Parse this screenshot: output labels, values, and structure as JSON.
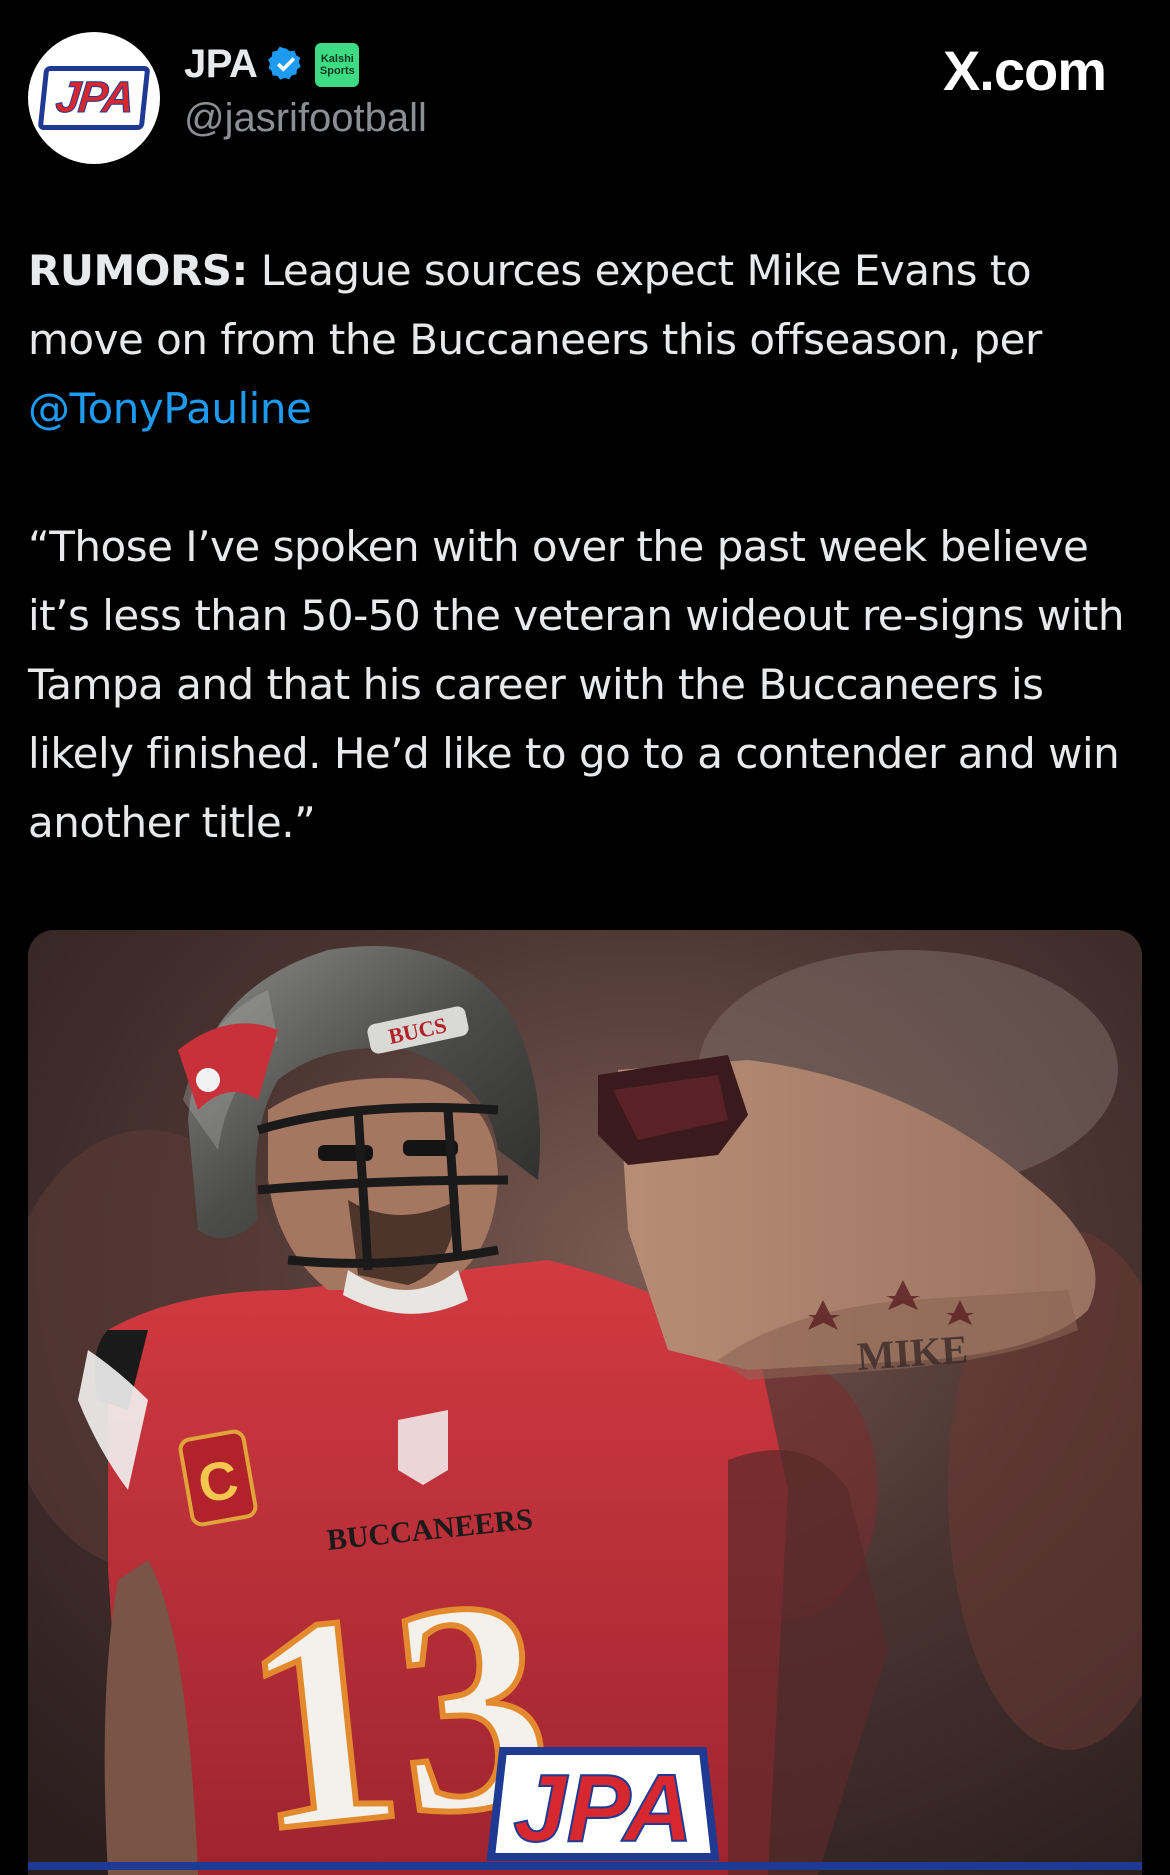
{
  "header": {
    "avatar_logo_text": "JPA",
    "display_name": "JPA",
    "affiliate_badge": "Kalshi Sports",
    "handle": "@jasrifootball",
    "site_label": "X.com"
  },
  "tweet": {
    "tag": "RUMORS:",
    "line1_text": " League sources expect Mike Evans to move on from the Buccaneers this offseason, per ",
    "mention": "@TonyPauline",
    "quote": "“Those I’ve spoken with over the past week believe it’s less than 50-50 the veteran wideout re-signs with Tampa and that his career with the Buccaneers is likely finished. He’d like to go to a contender and win another title.”"
  },
  "media": {
    "jersey_text": "BUCCANEERS",
    "jersey_number": "13",
    "helmet_text": "BUCS",
    "tattoo_text": "MIKE",
    "captain_patch": "C",
    "watermark": "JPA"
  },
  "colors": {
    "background": "#000000",
    "text": "#e7e9ea",
    "muted": "#8b8f94",
    "link": "#1d9bf0",
    "verified": "#1d9bf0",
    "jersey_red": "#c8303a",
    "logo_blue": "#1f3a93",
    "logo_red": "#d7282f"
  }
}
